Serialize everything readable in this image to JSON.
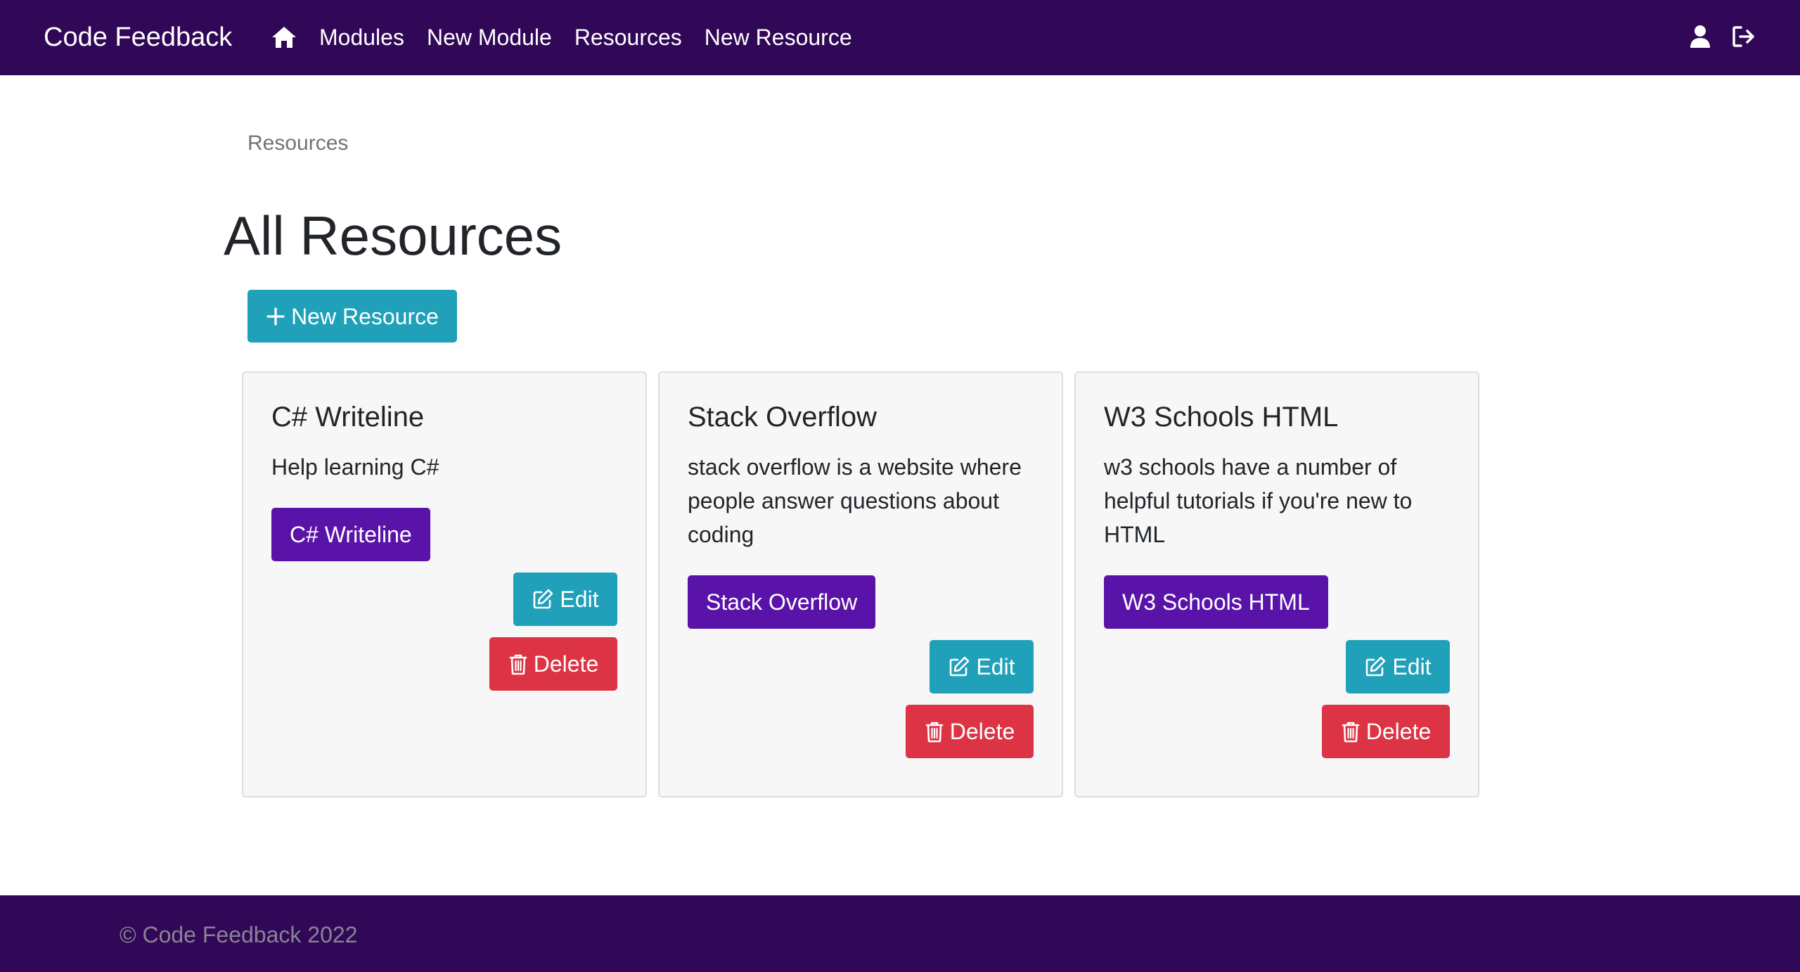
{
  "nav": {
    "brand": "Code Feedback",
    "links": [
      "Modules",
      "New Module",
      "Resources",
      "New Resource"
    ]
  },
  "breadcrumb": "Resources",
  "page_title": "All Resources",
  "new_resource_button": "New Resource",
  "resources": [
    {
      "title": "C# Writeline",
      "description": "Help learning C#",
      "link_label": "C# Writeline",
      "edit_label": "Edit",
      "delete_label": "Delete"
    },
    {
      "title": "Stack Overflow",
      "description": "stack overflow is a website where people answer questions about coding",
      "link_label": "Stack Overflow",
      "edit_label": "Edit",
      "delete_label": "Delete"
    },
    {
      "title": "W3 Schools HTML",
      "description": "w3 schools have a number of helpful tutorials if you're new to HTML",
      "link_label": "W3 Schools HTML",
      "edit_label": "Edit",
      "delete_label": "Delete"
    }
  ],
  "footer": "© Code Feedback 2022",
  "icons": {
    "home": "home-icon",
    "user": "user-icon",
    "logout": "logout-icon",
    "plus": "plus-icon",
    "edit": "edit-icon",
    "trash": "trash-icon"
  },
  "colors": {
    "navbar": "#310857",
    "info": "#21a1b9",
    "primary": "#5a13a8",
    "danger": "#dc3445"
  }
}
